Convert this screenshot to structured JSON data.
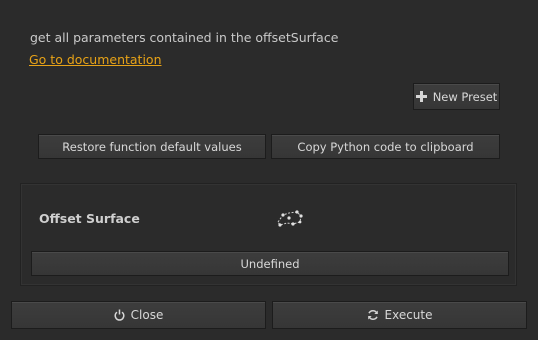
{
  "description": "get all parameters contained in the offsetSurface",
  "doc_link_label": "Go to documentation",
  "toolbar": {
    "new_preset_label": "New Preset",
    "new_preset_icon": "plus-icon"
  },
  "actions": {
    "restore_label": "Restore function default values",
    "copy_label": "Copy Python code to clipboard"
  },
  "parameter": {
    "title": "Offset Surface",
    "icon": "surface-points-icon",
    "value_label": "Undefined"
  },
  "footer": {
    "close_label": "Close",
    "close_icon": "power-icon",
    "execute_label": "Execute",
    "execute_icon": "refresh-icon"
  },
  "colors": {
    "background": "#2b2b2b",
    "link": "#e8a317",
    "text": "#c9c9c9"
  }
}
